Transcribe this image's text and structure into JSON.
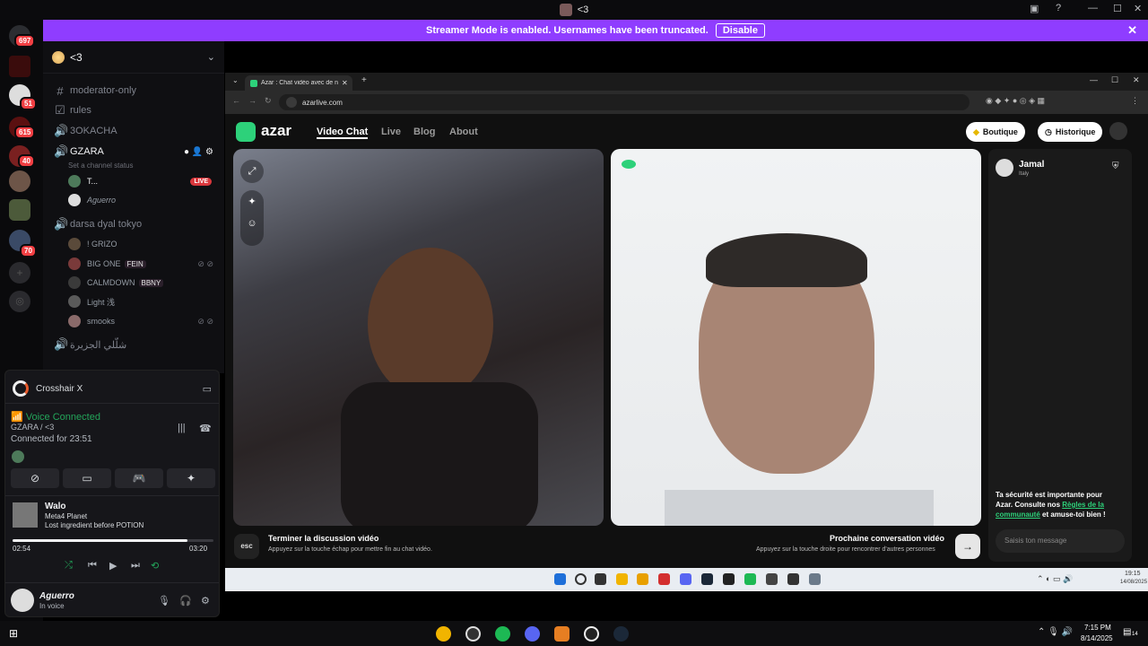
{
  "titlebar": {
    "title": "<3"
  },
  "banner": {
    "message": "Streamer Mode is enabled. Usernames have been truncated.",
    "disable_label": "Disable"
  },
  "rail": {
    "badges": [
      "697",
      "51",
      "615",
      "40",
      "70"
    ]
  },
  "server": {
    "name": "<3"
  },
  "channels": {
    "moderator_only": "moderator-only",
    "rules": "rules",
    "ch3": "3OKACHA",
    "gzara": "GZARA",
    "channel_status": "Set a channel status",
    "darsa": "darsa dyal tokyo",
    "last": "شلّلي الجزيرة"
  },
  "gzara_users": [
    {
      "name": "T...",
      "live": "LIVE"
    },
    {
      "name": "Aguerro"
    }
  ],
  "darsa_users": [
    {
      "name": "! GRIZO"
    },
    {
      "name": "BIG ONE",
      "tag": "FEIN"
    },
    {
      "name": "CALMDOWN",
      "tag": "BBNY"
    },
    {
      "name": "Light 浅"
    },
    {
      "name": "smooks"
    }
  ],
  "voice": {
    "app_name": "Crosshair X",
    "status": "Voice Connected",
    "location": "GZARA / <3",
    "duration": "Connected for 23:51"
  },
  "music": {
    "title": "Walo",
    "artist": "Meta4 Planet",
    "album": "Lost ingredient before POTION",
    "elapsed": "02:54",
    "total": "03:20",
    "progress": 0.87
  },
  "user": {
    "name": "Aguerro",
    "status": "In voice"
  },
  "browser": {
    "tab_title": "Azar : Chat vidéo avec de n",
    "url": "azarlive.com"
  },
  "azar": {
    "logo": "azar",
    "nav": [
      "Video Chat",
      "Live",
      "Blog",
      "About"
    ],
    "boutique": "Boutique",
    "historique": "Historique",
    "partner_name": "Jamal",
    "partner_country": "Italy",
    "safety_text": "Ta sécurité est importante pour Azar. Consulte nos",
    "safety_link": "Règles de la communauté",
    "safety_end": "et amuse-toi bien !",
    "end_title": "Terminer la discussion vidéo",
    "end_sub": "Appuyez sur la touche échap pour mettre fin au chat vidéo.",
    "next_title": "Prochaine conversation vidéo",
    "next_sub": "Appuyez sur la touche droite pour rencontrer d'autres personnes",
    "message_placeholder": "Saisis ton message",
    "esc": "esc"
  },
  "inner_clock": {
    "time": "19:15",
    "date": "14/08/2025"
  },
  "outer_clock": {
    "time": "7:15 PM",
    "date": "8/14/2025",
    "notif": "14"
  },
  "colors": {
    "accent": "#8f3dff",
    "azar_green": "#2dd17a",
    "discord_red": "#f23f43",
    "voice_green": "#23a55a"
  }
}
